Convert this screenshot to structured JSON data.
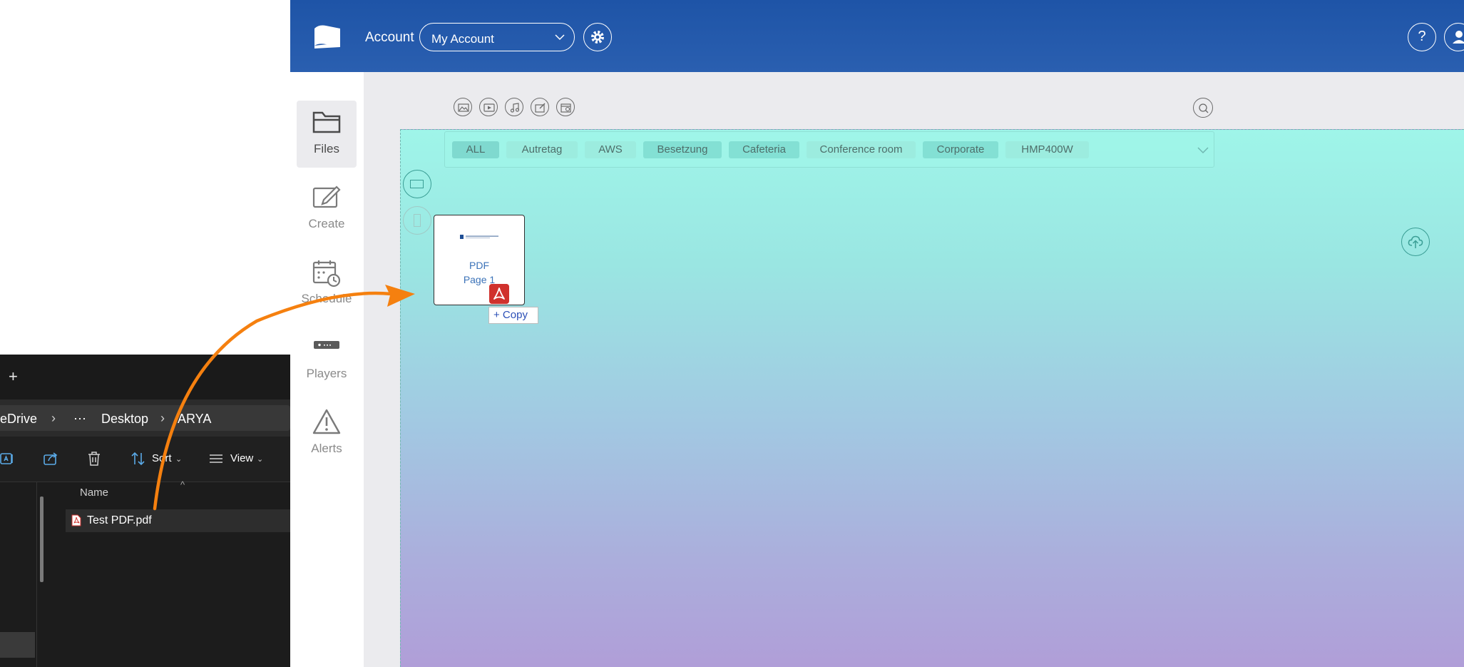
{
  "header": {
    "account_label": "Account",
    "account_select_value": "My Account",
    "help_label": "?"
  },
  "nav": {
    "items": [
      {
        "label": "Files",
        "icon": "folder-icon",
        "active": true
      },
      {
        "label": "Create",
        "icon": "create-icon",
        "active": false
      },
      {
        "label": "Schedule",
        "icon": "schedule-icon",
        "active": false
      },
      {
        "label": "Players",
        "icon": "player-icon",
        "active": false
      },
      {
        "label": "Alerts",
        "icon": "alert-icon",
        "active": false
      }
    ]
  },
  "media_filters": [
    "image-icon",
    "video-icon",
    "music-icon",
    "widget-icon",
    "playlist-icon"
  ],
  "tags": [
    "ALL",
    "Autretag",
    "AWS",
    "Besetzung",
    "Cafeteria",
    "Conference room",
    "Corporate",
    "HMP400W"
  ],
  "media_item": {
    "title": "PDF",
    "subtitle": "Page 1",
    "type_badge": "pdf-icon"
  },
  "drop_tooltip": "+ Copy",
  "explorer": {
    "new_tab": "+",
    "breadcrumb": [
      "eDrive",
      "⋯",
      "Desktop",
      "ARYA"
    ],
    "commands": {
      "sort": "Sort",
      "view": "View"
    },
    "column_name": "Name",
    "files": [
      {
        "name": "Test PDF.pdf",
        "icon": "pdf-file-icon"
      }
    ]
  },
  "colors": {
    "header_blue": "#1e54a7",
    "canvas_top": "#9ff5e9",
    "canvas_bottom": "#b09ed8",
    "drag_arrow": "#f5800f",
    "pdf_red": "#d0312d"
  }
}
